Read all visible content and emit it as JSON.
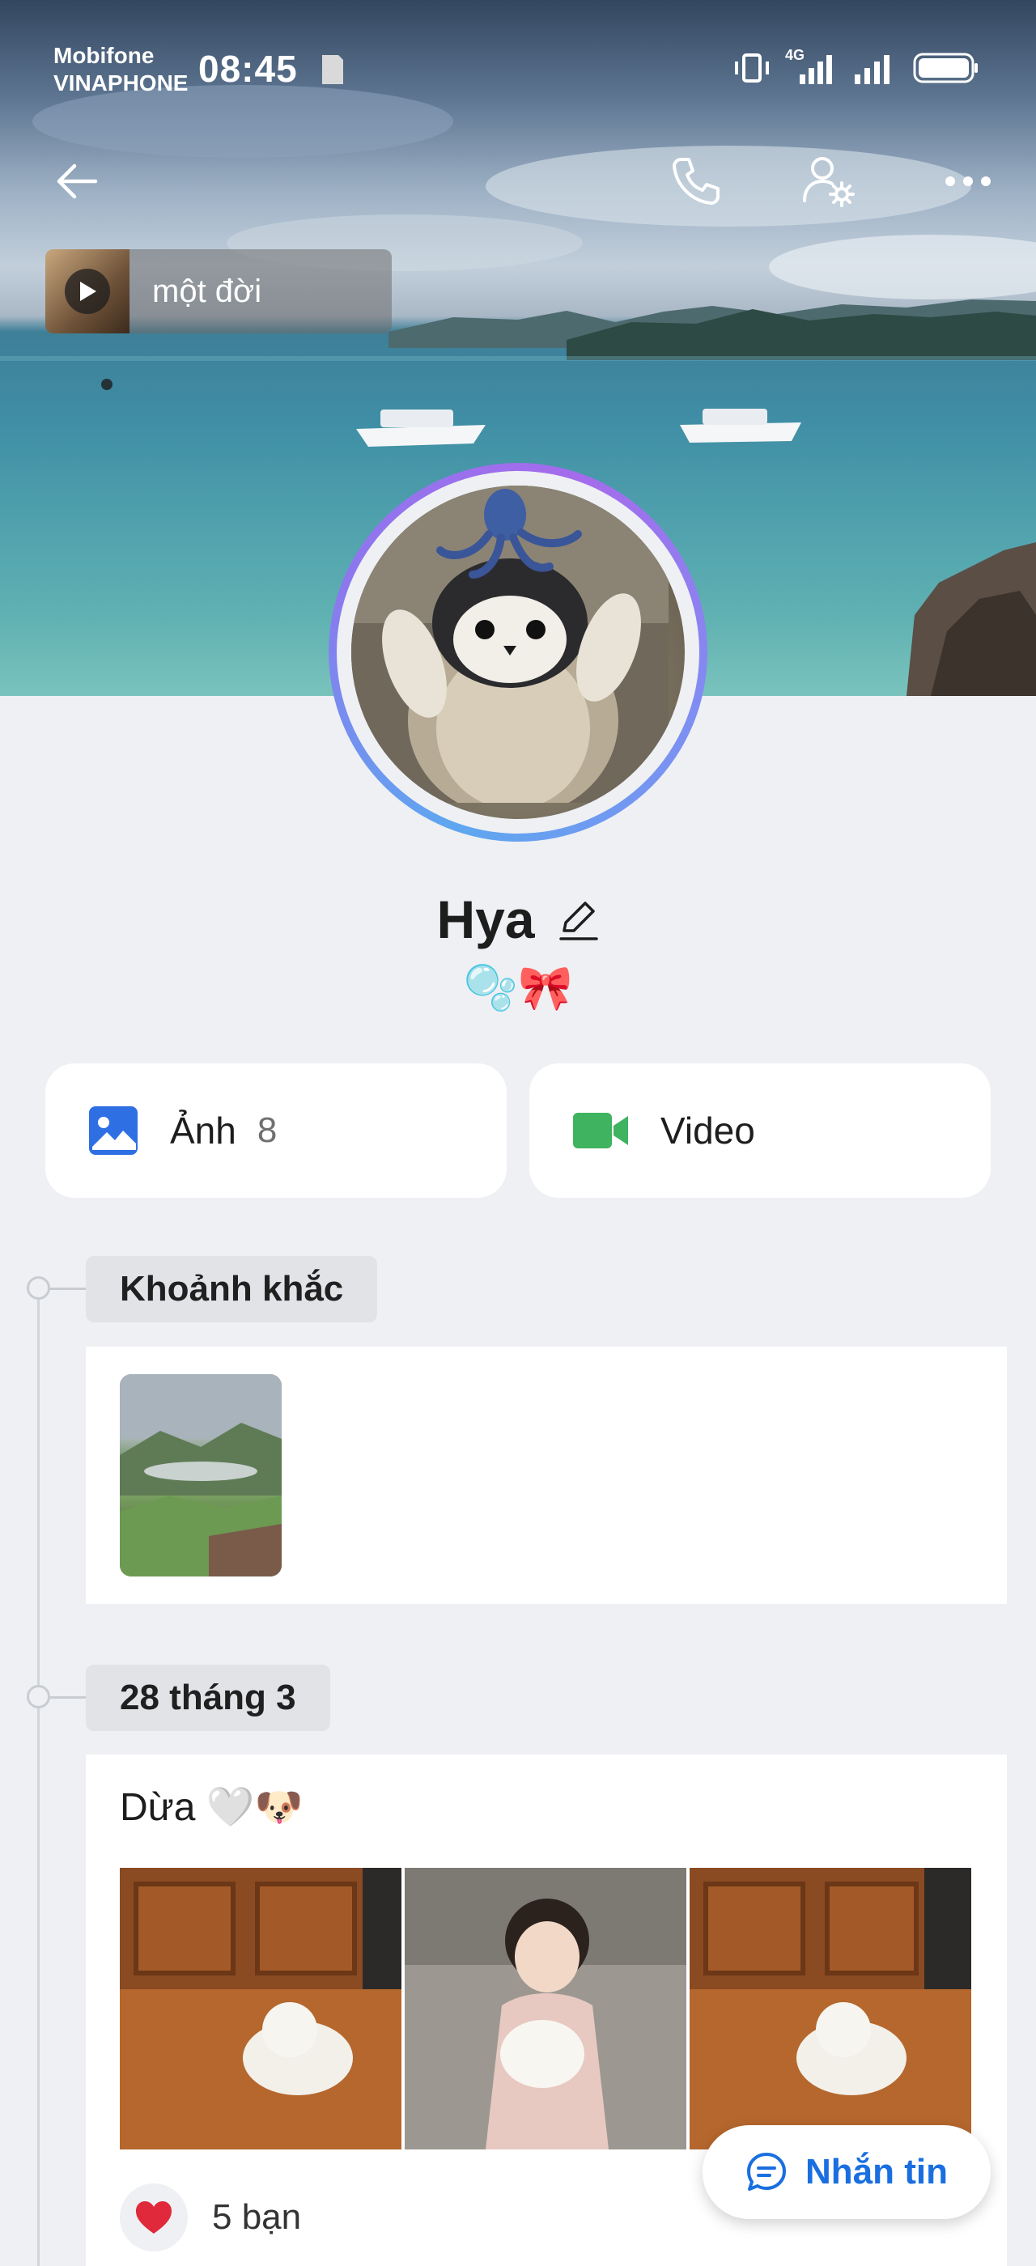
{
  "status_bar": {
    "carrier_1": "Mobifone",
    "carrier_2": "VINAPHONE",
    "time": "08:45",
    "network": "4G"
  },
  "top_actions": {
    "back_icon": "arrow-left-icon",
    "call_icon": "phone-icon",
    "settings_icon": "user-settings-icon",
    "more_icon": "more-horizontal-icon"
  },
  "music": {
    "title": "một đời"
  },
  "profile": {
    "name": "Hya",
    "bio": "🫧🎀"
  },
  "media": [
    {
      "label": "Ảnh",
      "count": "8",
      "icon": "image-icon",
      "color": "#2f6fe4"
    },
    {
      "label": "Video",
      "icon": "video-icon",
      "color": "#3fb35f"
    }
  ],
  "timeline": {
    "moments": {
      "label": "Khoảnh khắc"
    },
    "post": {
      "date": "28 tháng 3",
      "text": "Dừa 🤍🐶",
      "reactions": {
        "icon": "❤️",
        "count": "5 bạn"
      }
    }
  },
  "message_button": {
    "label": "Nhắn tin"
  }
}
